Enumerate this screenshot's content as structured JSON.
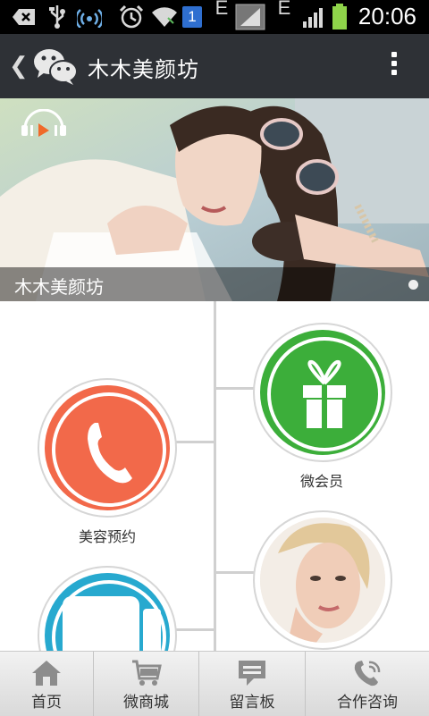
{
  "status_bar": {
    "time": "20:06",
    "sim_number": "1",
    "network_labels": [
      "E",
      "E"
    ]
  },
  "header": {
    "title": "木木美颜坊"
  },
  "banner": {
    "caption": "木木美颜坊"
  },
  "tiles": [
    {
      "label": "微会员",
      "color": "#3cae3a"
    },
    {
      "label": "美容预约",
      "color": "#f2694a"
    },
    {
      "label": "",
      "color": "#efe3d8"
    },
    {
      "label": "",
      "color": "#27a9cf"
    }
  ],
  "bottom_nav": [
    {
      "label": "首页",
      "icon": "home-icon"
    },
    {
      "label": "微商城",
      "icon": "cart-icon"
    },
    {
      "label": "留言板",
      "icon": "message-icon"
    },
    {
      "label": "合作咨询",
      "icon": "phone-icon"
    }
  ]
}
